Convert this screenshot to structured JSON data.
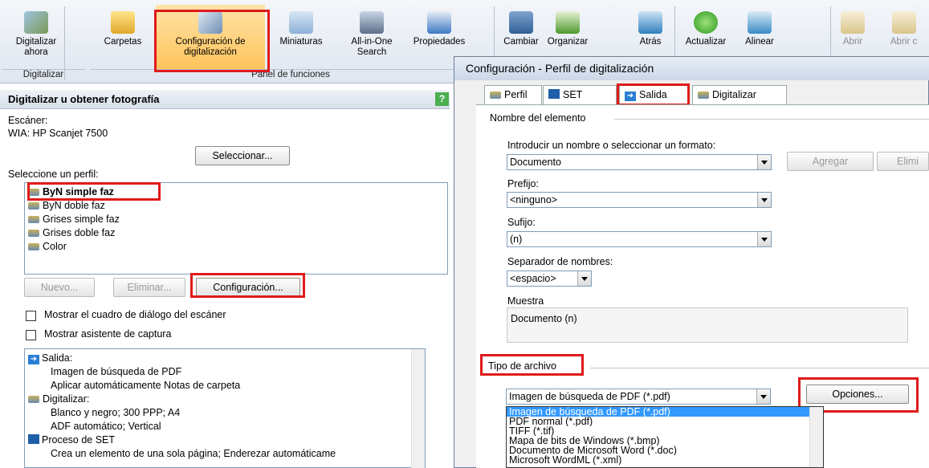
{
  "ribbon": {
    "buttons": [
      {
        "label": "Digitalizar ahora"
      },
      {
        "label": "Carpetas"
      },
      {
        "label": "Configuración de digitalización"
      },
      {
        "label": "Miniaturas"
      },
      {
        "label": "All-in-One Search"
      },
      {
        "label": "Propiedades"
      },
      {
        "label": "Cambiar"
      },
      {
        "label": "Organizar"
      },
      {
        "label": "Atrás"
      },
      {
        "label": "Actualizar"
      },
      {
        "label": "Alinear"
      },
      {
        "label": "Abrir"
      },
      {
        "label": "Abrir c"
      }
    ],
    "groups": {
      "digitalizar": "Digitalizar",
      "panel": "Panel de funciones"
    }
  },
  "left": {
    "title": "Digitalizar u obtener fotografía",
    "scanner_label": "Escáner:",
    "scanner_value": "WIA: HP Scanjet 7500",
    "select_button": "Seleccionar...",
    "profile_label": "Seleccione un perfil:",
    "profiles": [
      "ByN simple faz",
      "ByN doble faz",
      "Grises simple faz",
      "Grises doble faz",
      "Color"
    ],
    "new_button": "Nuevo...",
    "delete_button": "Eliminar...",
    "config_button": "Configuración...",
    "check1": "Mostrar el cuadro de diálogo del escáner",
    "check2": "Mostrar asistente de captura",
    "summary": [
      "Salida:",
      "Imagen de búsqueda de PDF",
      "Aplicar automáticamente Notas de carpeta",
      "Digitalizar:",
      "Blanco y negro; 300 PPP; A4",
      "ADF automático; Vertical",
      "Proceso de SET",
      "Crea un elemento de una sola página; Enderezar automáticame"
    ]
  },
  "dialog": {
    "title": "Configuración - Perfil de digitalización",
    "tabs": [
      "Perfil",
      "SET",
      "Salida",
      "Digitalizar"
    ],
    "item_name_section": "Nombre del elemento",
    "name_label": "Introducir un nombre o seleccionar un formato:",
    "name_value": "Documento",
    "add_button": "Agregar",
    "delete_button": "Elimi",
    "prefix_label": "Prefijo:",
    "prefix_value": "<ninguno>",
    "suffix_label": "Sufijo:",
    "suffix_value": "(n)",
    "separator_label": "Separador de nombres:",
    "separator_value": "<espacio>",
    "sample_label": "Muestra",
    "sample_value": "Documento (n)",
    "filetype_section": "Tipo de archivo",
    "filetype_value": "Imagen de búsqueda de PDF (*.pdf)",
    "options_button": "Opciones...",
    "filetype_options": [
      "Imagen de búsqueda de PDF (*.pdf)",
      "PDF normal (*.pdf)",
      "TIFF (*.tif)",
      "Mapa de bits de Windows (*.bmp)",
      "Documento de Microsoft Word (*.doc)",
      "Microsoft WordML (*.xml)"
    ]
  },
  "colors": {
    "highlight": "#e01a1a",
    "selection": "#3399ff"
  }
}
